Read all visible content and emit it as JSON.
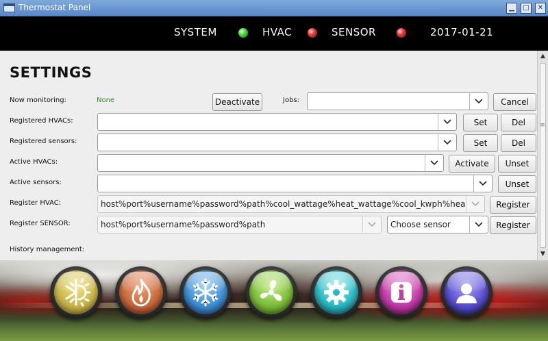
{
  "window": {
    "title": "Thermostat Panel",
    "min_label": "▁",
    "max_label": "□",
    "close_label": "✕"
  },
  "status": {
    "system_label": "SYSTEM",
    "hvac_label": "HVAC",
    "sensor_label": "SENSOR",
    "date": "2017-01-21",
    "system_state_color": "#4cd63a",
    "hvac_state_color": "#e23a3a",
    "sensor_state_color": "#e23a3a"
  },
  "settings": {
    "heading": "SETTINGS",
    "now_monitoring_label": "Now monitoring:",
    "now_monitoring_value": "None",
    "deactivate_label": "Deactivate",
    "jobs_label": "Jobs:",
    "jobs_value": "",
    "cancel_label": "Cancel",
    "registered_hvacs_label": "Registered HVACs:",
    "registered_hvacs_value": "",
    "registered_sensors_label": "Registered sensors:",
    "registered_sensors_value": "",
    "active_hvacs_label": "Active HVACs:",
    "active_hvacs_value": "",
    "active_sensors_label": "Active sensors:",
    "active_sensors_value": "",
    "register_hvac_label": "Register HVAC:",
    "register_hvac_value": "host%port%username%password%path%cool_wattage%heat_wattage%cool_kwph%heat_kwph",
    "register_sensor_label": "Register SENSOR:",
    "register_sensor_value": "host%port%username%password%path",
    "choose_sensor_value": "Choose sensor",
    "history_label": "History management:",
    "set_label": "Set",
    "del_label": "Del",
    "activate_label": "Activate",
    "unset_label": "Unset",
    "register_label": "Register"
  },
  "dock": {
    "buttons": [
      {
        "icon": "sun-snowflake-icon",
        "color": "#c9b54a"
      },
      {
        "icon": "flame-icon",
        "color": "#c86a3e"
      },
      {
        "icon": "snowflake-icon",
        "color": "#3f8ed3"
      },
      {
        "icon": "fan-icon",
        "color": "#7dbd3a"
      },
      {
        "icon": "gear-icon",
        "color": "#2bb7c2"
      },
      {
        "icon": "info-icon",
        "color": "#c23aa7"
      },
      {
        "icon": "user-icon",
        "color": "#5a4fd0"
      }
    ]
  }
}
